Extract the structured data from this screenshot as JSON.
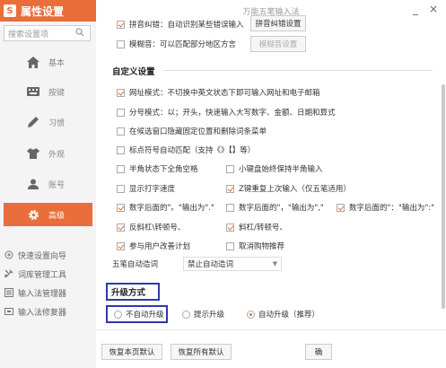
{
  "app": {
    "title": "属性设置",
    "logo": "S",
    "window_title": "万能五笔输入法"
  },
  "search": {
    "placeholder": "搜索设置项"
  },
  "sidebar": {
    "items": [
      {
        "label": "基本",
        "icon": "home-icon"
      },
      {
        "label": "按键",
        "icon": "keyboard-icon"
      },
      {
        "label": "习惯",
        "icon": "pen-icon"
      },
      {
        "label": "外观",
        "icon": "shirt-icon"
      },
      {
        "label": "账号",
        "icon": "user-icon"
      },
      {
        "label": "高级",
        "icon": "gear-icon",
        "active": true
      }
    ],
    "tools": [
      {
        "label": "快速设置向导",
        "icon": "wizard-icon"
      },
      {
        "label": "词库管理工具",
        "icon": "tools-icon"
      },
      {
        "label": "输入法管理器",
        "icon": "manager-icon"
      },
      {
        "label": "输入法修复器",
        "icon": "repair-icon"
      }
    ]
  },
  "window": {
    "minimize": "_",
    "close": "×"
  },
  "top_options": {
    "pinyin_correction": {
      "label": "拼音纠错：自动识别某些错误输入",
      "checked": true,
      "button": "拼音纠错设置"
    },
    "fuzzy_pinyin": {
      "label": "模糊音：可以匹配部分地区方言",
      "checked": false,
      "button": "模糊音设置"
    }
  },
  "custom": {
    "title": "自定义设置",
    "options": [
      {
        "label": "网址模式：不切换中英文状态下即可输入网址和电子邮箱",
        "checked": true
      },
      {
        "label": "分号模式：以；开头，快速输入大写数字、金额、日期和算式",
        "checked": false
      },
      {
        "label": "在候选窗口隐藏固定位置和删除词条菜单",
        "checked": false
      },
      {
        "label": "标点符号自动匹配（支持《》【】等）",
        "checked": false
      }
    ],
    "grid": [
      [
        {
          "label": "半角状态下全角空格",
          "checked": false
        },
        {
          "label": "小键盘始终保持半角输入",
          "checked": false
        }
      ],
      [
        {
          "label": "显示打字速度",
          "checked": false
        },
        {
          "label": "Z键重复上次输入（仅五笔适用）",
          "checked": true
        }
      ],
      [
        {
          "label": "数字后面的\"。\"输出为\".\"",
          "checked": true
        },
        {
          "label": "数字后面的\"，\"输出为\",\"",
          "checked": false
        },
        {
          "label": "数字后面的\"：\"输出为\":\"",
          "checked": true
        }
      ],
      [
        {
          "label": "反斜杠\\转顿号、",
          "checked": true
        },
        {
          "label": "斜杠/转顿号、",
          "checked": true
        }
      ],
      [
        {
          "label": "参与用户改善计划",
          "checked": true
        },
        {
          "label": "取消购物推荐",
          "checked": false
        }
      ]
    ],
    "wubi_label": "五笔自动造词",
    "wubi_value": "禁止自动造词"
  },
  "upgrade": {
    "title": "升级方式",
    "options": [
      {
        "label": "不自动升级",
        "checked": false
      },
      {
        "label": "提示升级",
        "checked": false
      },
      {
        "label": "自动升级（推荐）",
        "checked": true
      }
    ]
  },
  "footer": {
    "restore_page": "恢复本页默认",
    "restore_all": "恢复所有默认",
    "extra": "确"
  }
}
